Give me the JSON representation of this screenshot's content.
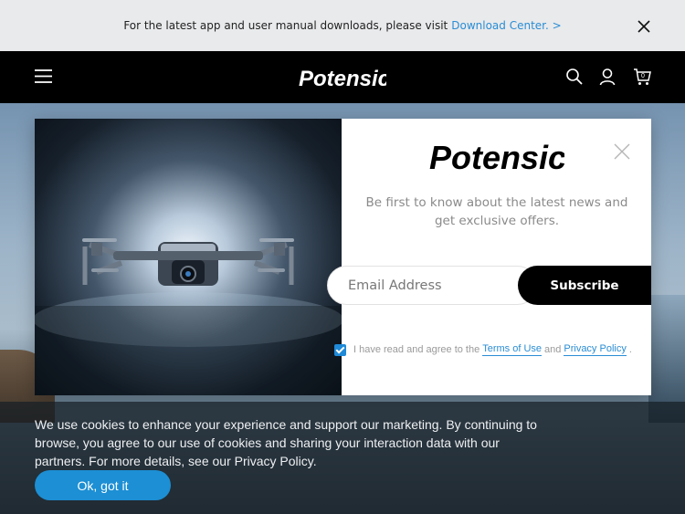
{
  "announcement": {
    "text": "For the latest app and user manual downloads, please visit",
    "link": "Download Center. >"
  },
  "nav": {
    "logo": "Potensic",
    "icons": [
      "menu-icon",
      "search-icon",
      "account-icon",
      "cart-icon"
    ],
    "cart_count": "0"
  },
  "modal": {
    "logo": "Potensic",
    "tagline": "Be first to know about the latest news and get exclusive offers.",
    "email_placeholder": "Email Address",
    "subscribe_label": "Subscribe",
    "agree_prefix": "I have read and agree to the",
    "terms_label": "Terms of Use",
    "and_label": "and",
    "privacy_label": "Privacy Policy",
    "agree_suffix": ".",
    "agree_checked": true
  },
  "cookie": {
    "text": "We use cookies to enhance your experience and support our marketing. By continuing to browse, you agree to our use of cookies and sharing your interaction data with our partners. For more details, see our Privacy Policy.",
    "ok_label": "Ok, got it"
  },
  "colors": {
    "accent": "#2a8dd4",
    "nav_bg": "#000000",
    "announce_bg": "#e9eaec",
    "cookie_button": "#1d8fd4"
  }
}
